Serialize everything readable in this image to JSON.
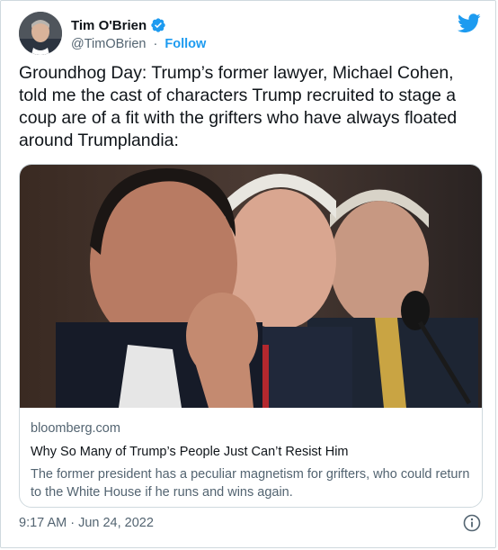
{
  "author": {
    "name": "Tim O'Brien",
    "handle": "@TimOBrien",
    "separator": "·",
    "follow_label": "Follow"
  },
  "tweet": {
    "text": "Groundhog Day: Trump’s former lawyer, Michael Cohen, told me the cast of characters Trump recruited to stage a coup are of a fit with the grifters who have always floated around Trumplandia:",
    "timestamp": "9:17 AM · Jun 24, 2022"
  },
  "card": {
    "domain": "bloomberg.com",
    "title": "Why So Many of Trump’s People Just Can’t Resist Him",
    "description": "The former president has a peculiar magnetism for grifters, who could return to the White House if he runs and wins again."
  },
  "icons": {
    "verified": "verified-badge-icon",
    "brand": "twitter-bird-icon",
    "info": "info-icon"
  },
  "colors": {
    "accent": "#1d9bf0",
    "text": "#0f1419",
    "secondary": "#536471",
    "border": "#cfd9de"
  }
}
